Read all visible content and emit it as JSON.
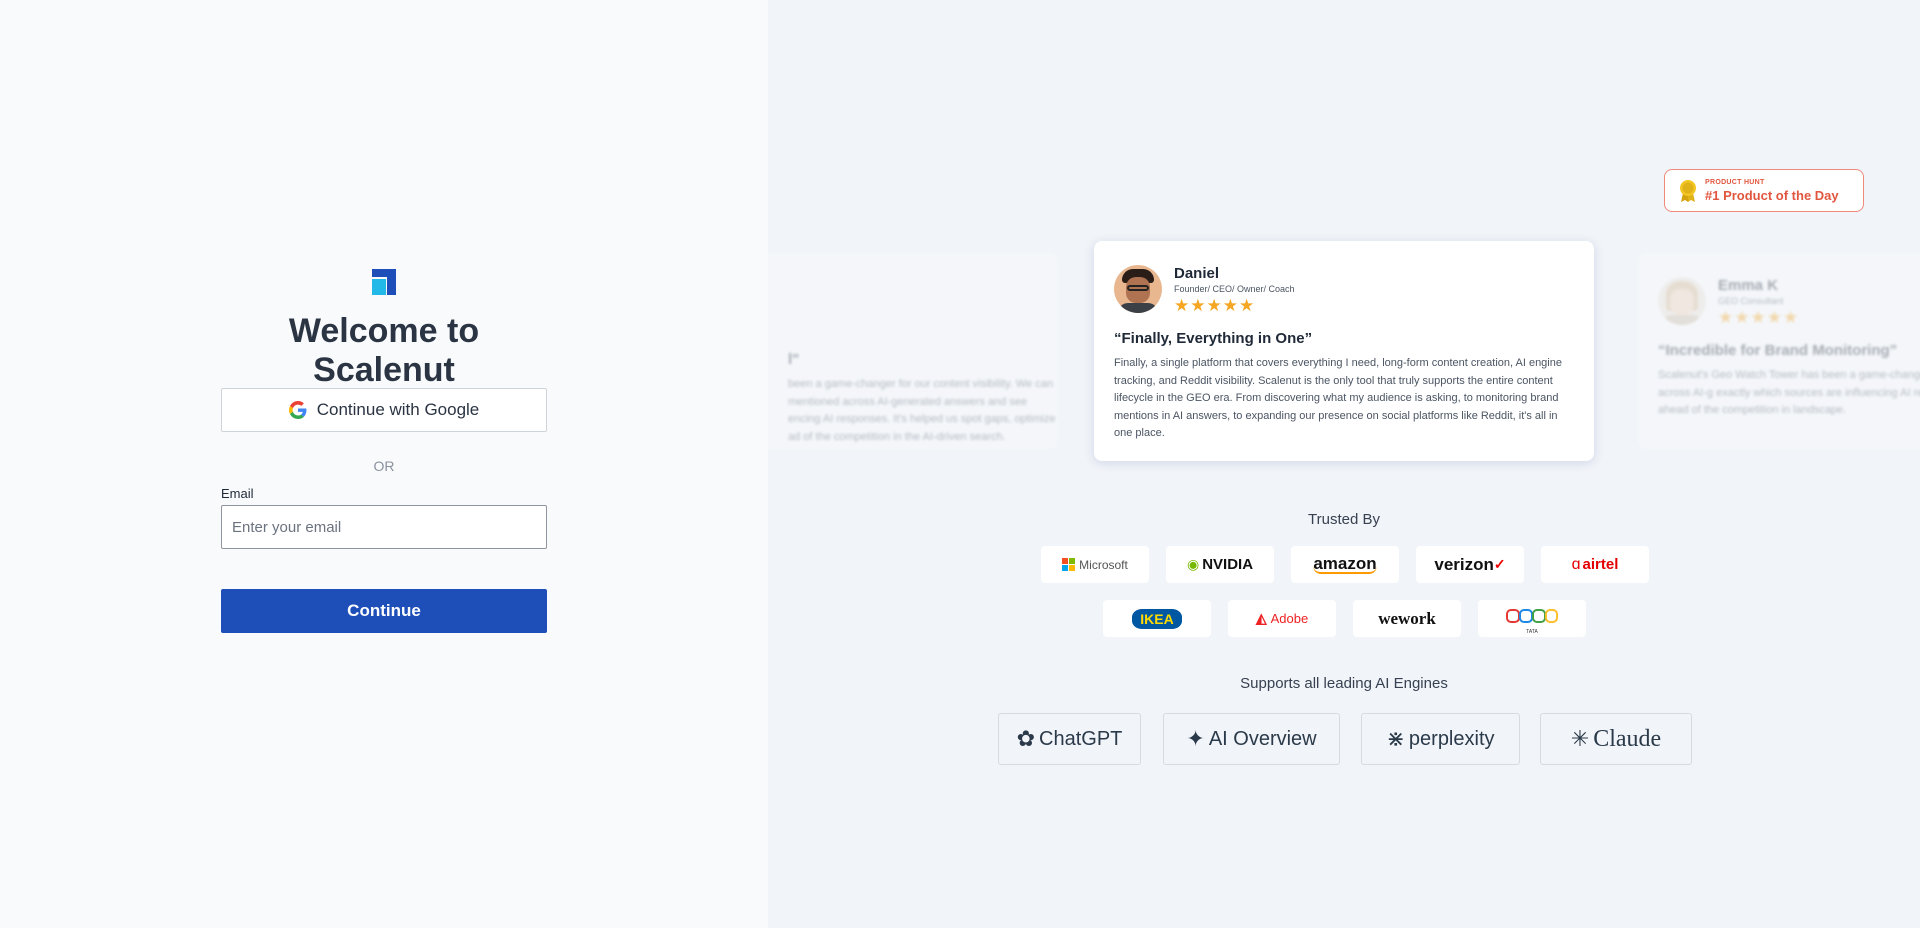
{
  "login": {
    "title": "Welcome to Scalenut",
    "google_button": "Continue with Google",
    "or_text": "OR",
    "email_label": "Email",
    "email_placeholder": "Enter your email",
    "email_value": "",
    "continue_button": "Continue"
  },
  "badge": {
    "small": "PRODUCT HUNT",
    "big": "#1 Product of the Day"
  },
  "testimonials": {
    "left": {
      "title": "l\"",
      "body": "been a game-changer for our content visibility. We can mentioned across AI-generated answers and see encing AI responses. It's helped us spot gaps, optimize ad of the competition in the AI-driven search."
    },
    "main": {
      "name": "Daniel",
      "role": "Founder/ CEO/ Owner/ Coach",
      "stars": "★★★★★",
      "title": "“Finally, Everything in One”",
      "body": "Finally, a single platform that covers everything I need, long-form content creation, AI engine tracking, and Reddit visibility. Scalenut is the only tool that truly supports the entire content lifecycle in the GEO era. From discovering what my audience is asking, to monitoring brand mentions in AI answers, to expanding our presence on social platforms like Reddit, it's all in one place."
    },
    "right": {
      "name": "Emma K",
      "role": "GEO Consultant",
      "stars": "★★★★★",
      "title": "“Incredible for Brand Monitoring”",
      "body": "Scalenut's Geo Watch Tower has been a game-changer now track how often our brand is mentioned across AI-g exactly which sources are influencing AI responses. It's content placement, and stay ahead of the competition in landscape."
    }
  },
  "trusted": {
    "title": "Trusted By",
    "brands": [
      "Microsoft",
      "NVIDIA",
      "amazon",
      "verizon",
      "airtel",
      "IKEA",
      "Adobe",
      "wework",
      "TATA"
    ]
  },
  "engines": {
    "title": "Supports all leading AI Engines",
    "items": [
      "ChatGPT",
      "AI Overview",
      "perplexity",
      "Claude"
    ]
  },
  "colors": {
    "primary": "#1e4fb8",
    "logo_light": "#22b8e8",
    "badge": "#e1563f",
    "star": "#f5a623"
  }
}
